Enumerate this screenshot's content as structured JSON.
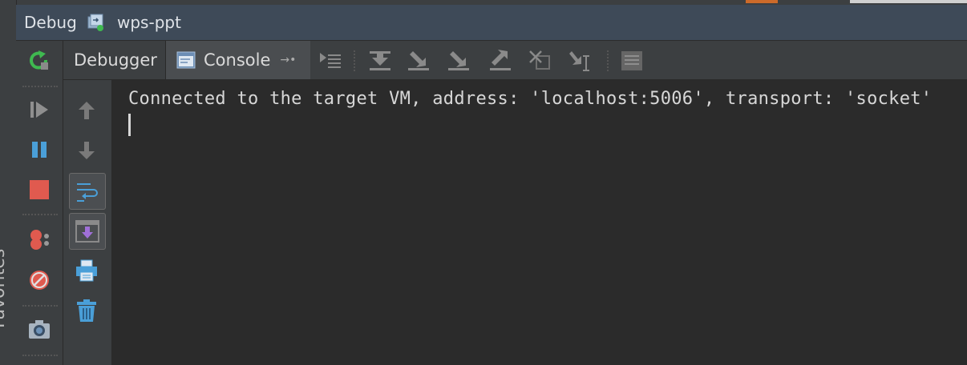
{
  "window": {
    "title": "Debug",
    "project": "wps-ppt"
  },
  "gutter": {
    "label": "Favorites"
  },
  "tabs": [
    {
      "label": "Debugger"
    },
    {
      "label": "Console"
    }
  ],
  "toolbar_icons": [
    "show-execution-point-icon",
    "step-over-icon",
    "step-into-icon",
    "force-step-into-icon",
    "step-out-icon",
    "drop-frame-icon",
    "run-to-cursor-icon",
    "evaluate-expression-icon"
  ],
  "side_icons": [
    "rerun-icon",
    "resume-icon",
    "pause-icon",
    "stop-icon",
    "view-breakpoints-icon",
    "mute-breakpoints-icon",
    "camera-icon"
  ],
  "console_icons": [
    "up-arrow-icon",
    "down-arrow-icon",
    "soft-wrap-icon",
    "scroll-to-end-icon",
    "print-icon",
    "clear-all-icon"
  ],
  "console": {
    "output": "Connected to the target VM, address: 'localhost:5006', transport: 'socket'"
  },
  "colors": {
    "title_bar": "#3e4a58",
    "panel": "#3c3f41",
    "console_bg": "#2b2b2b",
    "text": "#d7d7d7",
    "rerun_green": "#3fb950",
    "stop_red": "#e05a4f",
    "pause_blue": "#4a9fd8"
  }
}
